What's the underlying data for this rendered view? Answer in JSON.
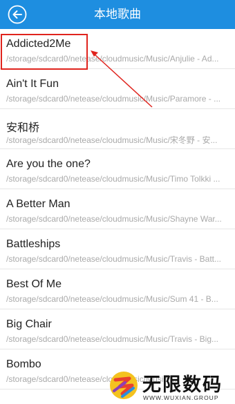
{
  "header": {
    "title": "本地歌曲",
    "back_icon": "back-arrow-circle-icon",
    "background_color": "#1e8ee0"
  },
  "songs": [
    {
      "title": "Addicted2Me",
      "path": "/storage/sdcard0/netease/cloudmusic/Music/Anjulie - Ad..."
    },
    {
      "title": "Ain't It Fun",
      "path": "/storage/sdcard0/netease/cloudmusic/Music/Paramore - ..."
    },
    {
      "title": "安和桥",
      "path": "/storage/sdcard0/netease/cloudmusic/Music/宋冬野 - 安..."
    },
    {
      "title": "Are you the one?",
      "path": "/storage/sdcard0/netease/cloudmusic/Music/Timo Tolkki ..."
    },
    {
      "title": "A Better Man",
      "path": "/storage/sdcard0/netease/cloudmusic/Music/Shayne War..."
    },
    {
      "title": "Battleships",
      "path": "/storage/sdcard0/netease/cloudmusic/Music/Travis - Batt..."
    },
    {
      "title": "Best Of Me",
      "path": "/storage/sdcard0/netease/cloudmusic/Music/Sum 41 - B..."
    },
    {
      "title": "Big Chair",
      "path": "/storage/sdcard0/netease/cloudmusic/Music/Travis - Big..."
    },
    {
      "title": "Bombo",
      "path": "/storage/sdcard0/netease/cloudmusic/Music/..."
    }
  ],
  "annotation": {
    "color": "#e0231d"
  },
  "watermark": {
    "name": "无限数码",
    "sub": "WWW.WUXIAN.GROUP"
  }
}
